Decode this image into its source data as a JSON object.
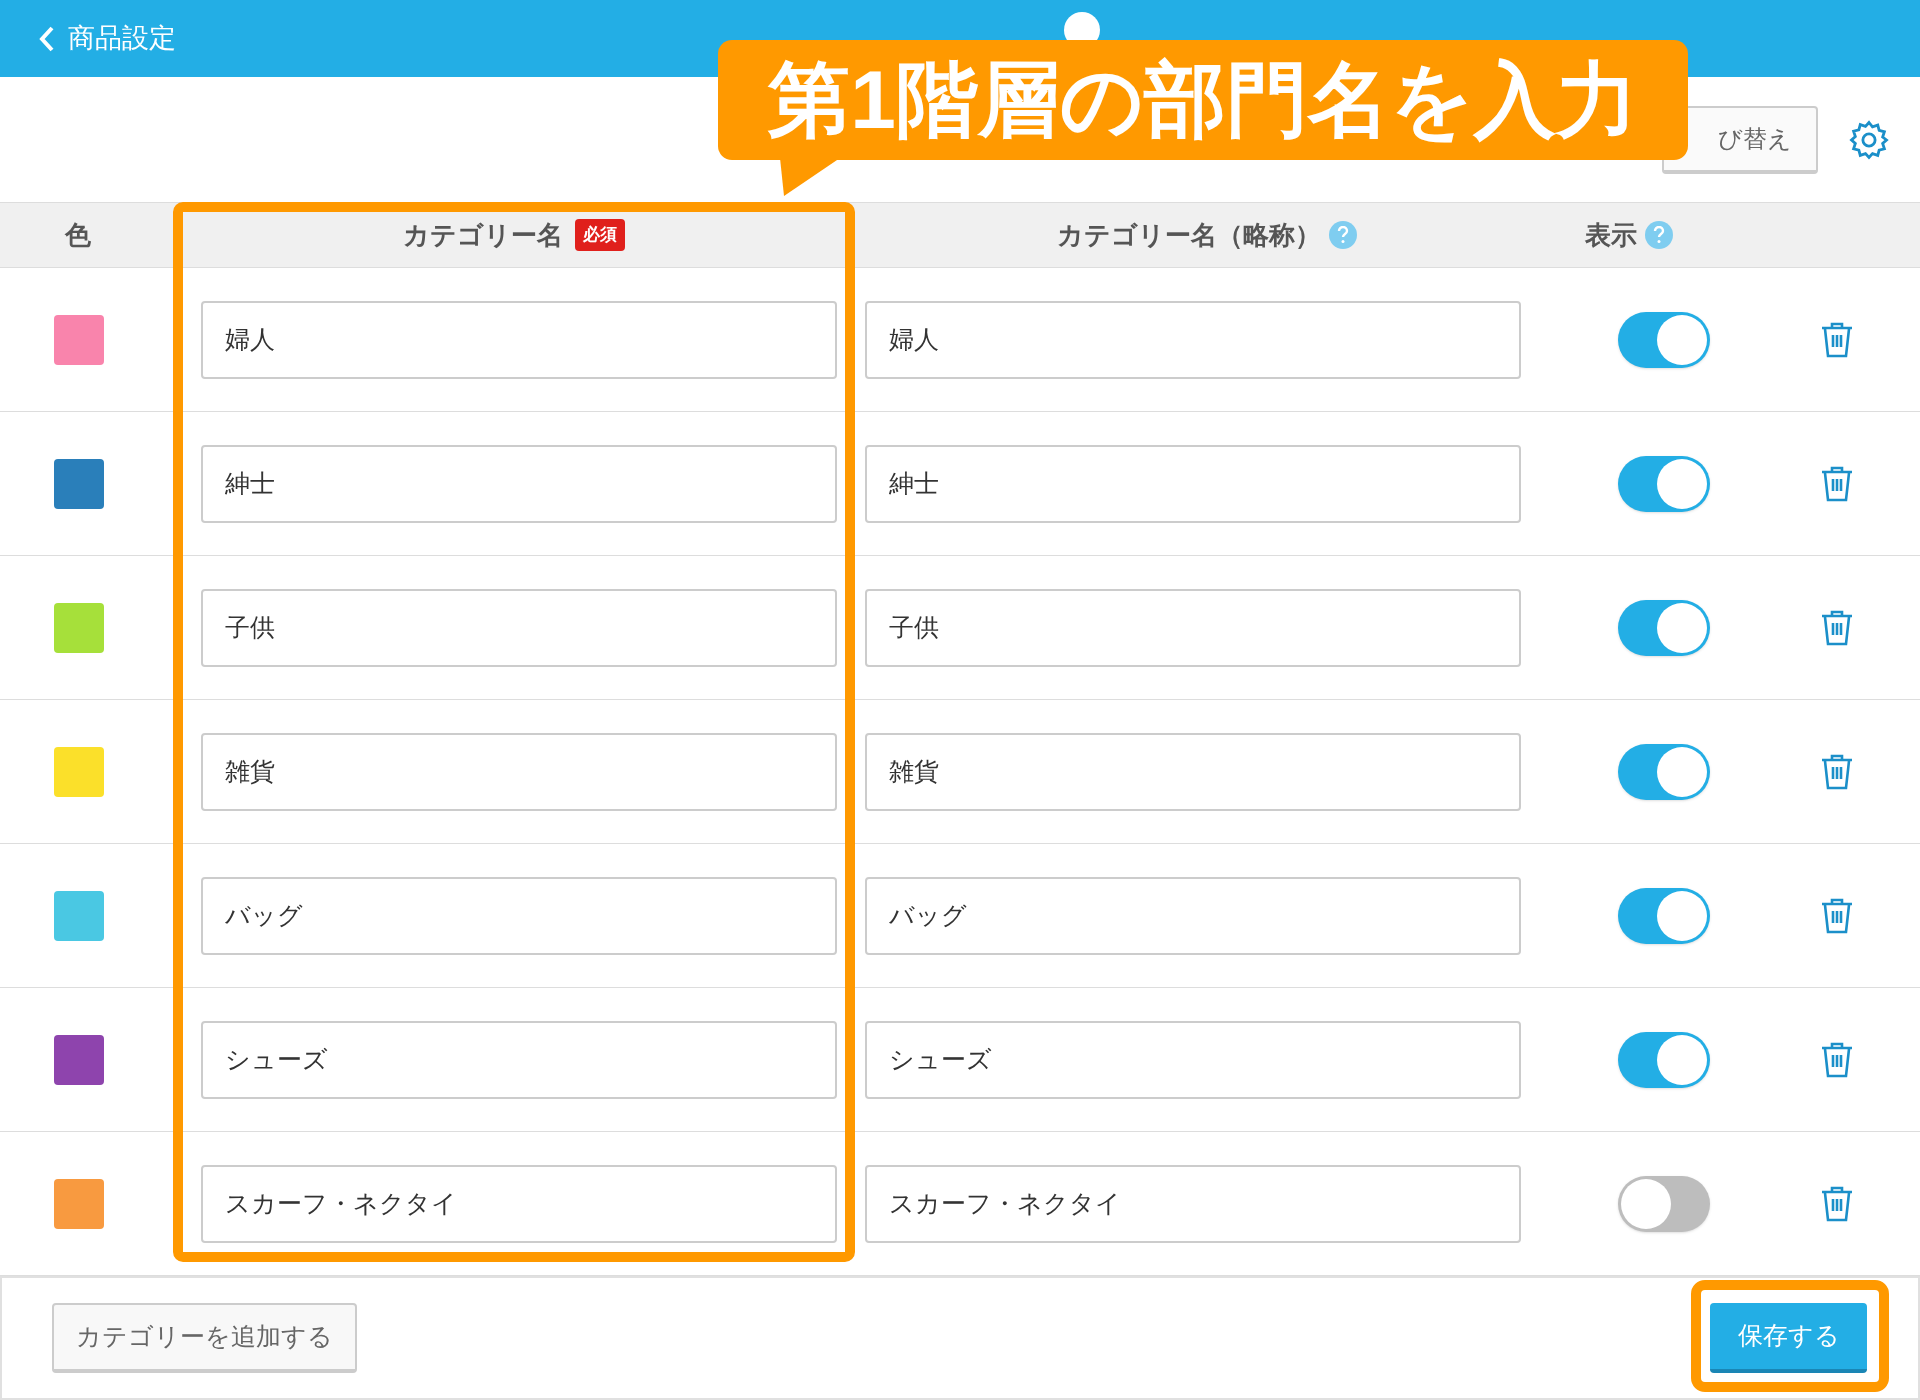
{
  "header": {
    "back_label": "商品設定"
  },
  "toolbar": {
    "sort_button": "び替え"
  },
  "table": {
    "columns": [
      "色",
      "カテゴリー名",
      "カテゴリー名（略称）",
      "表示"
    ],
    "required_badge": "必須",
    "rows": [
      {
        "color": "#f984ac",
        "name": "婦人",
        "short_name": "婦人",
        "on": true
      },
      {
        "color": "#2a7fba",
        "name": "紳士",
        "short_name": "紳士",
        "on": true
      },
      {
        "color": "#a6e03a",
        "name": "子供",
        "short_name": "子供",
        "on": true
      },
      {
        "color": "#fbe02a",
        "name": "雑貨",
        "short_name": "雑貨",
        "on": true
      },
      {
        "color": "#4ac8e3",
        "name": "バッグ",
        "short_name": "バッグ",
        "on": true
      },
      {
        "color": "#8e44ad",
        "name": "シューズ",
        "short_name": "シューズ",
        "on": true
      },
      {
        "color": "#f89a40",
        "name": "スカーフ・ネクタイ",
        "short_name": "スカーフ・ネクタイ",
        "on": false
      }
    ]
  },
  "footer": {
    "add_button": "カテゴリーを追加する",
    "save_button": "保存する"
  },
  "annotation": {
    "callout": "第1階層の部門名を入力"
  }
}
